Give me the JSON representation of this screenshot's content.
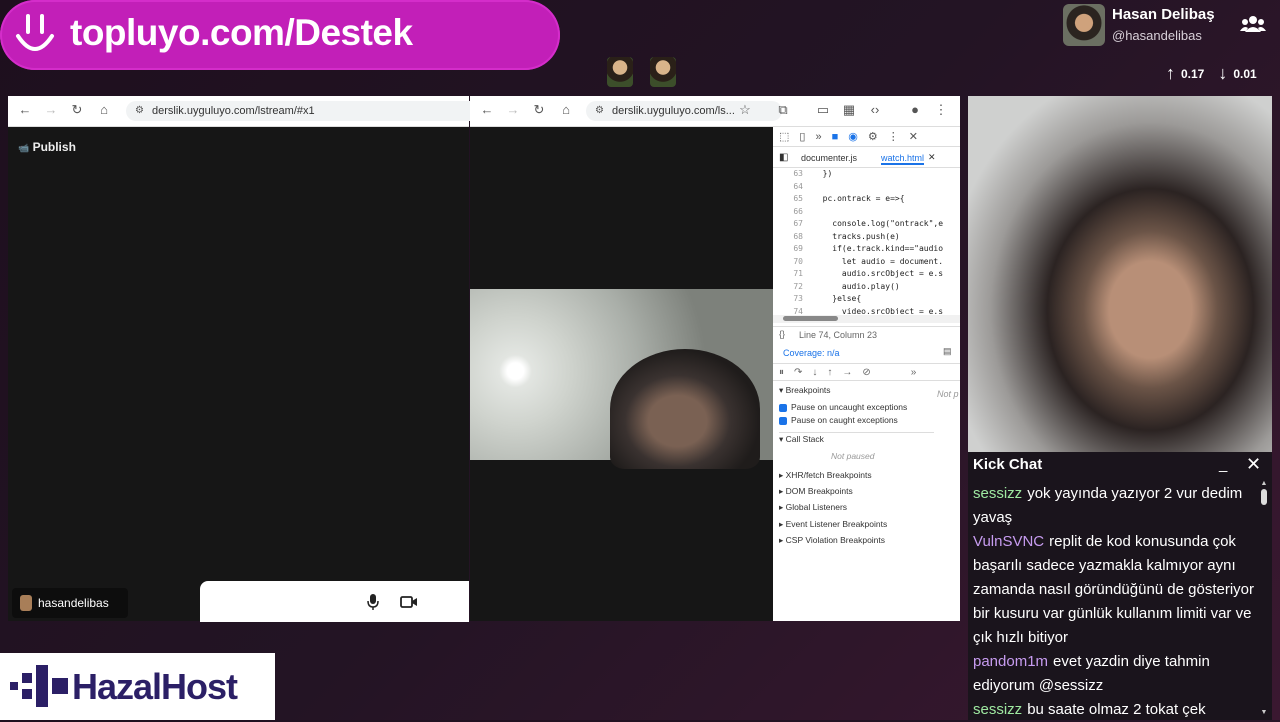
{
  "banner": {
    "text": "topluyo.com/Destek"
  },
  "profile": {
    "name": "Hasan Delibaş",
    "handle": "@hasandelibas",
    "up": "0.17",
    "down": "0.01"
  },
  "browser1": {
    "url": "derslik.uyguluyo.com/lstream/#x1",
    "publish": "Publish",
    "username": "hasandelibas"
  },
  "browser2": {
    "url": "derslik.uyguluyo.com/ls..."
  },
  "devtools": {
    "tabs": [
      "documenter.js",
      "watch.html"
    ],
    "lines": [
      {
        "n": "63",
        "c": "  })"
      },
      {
        "n": "64",
        "c": ""
      },
      {
        "n": "65",
        "c": "  pc.ontrack = e=>{"
      },
      {
        "n": "66",
        "c": ""
      },
      {
        "n": "67",
        "c": "    console.log(\"ontrack\",e"
      },
      {
        "n": "68",
        "c": "    tracks.push(e)"
      },
      {
        "n": "69",
        "c": "    if(e.track.kind==\"audio"
      },
      {
        "n": "70",
        "c": "      let audio = document."
      },
      {
        "n": "71",
        "c": "      audio.srcObject = e.s"
      },
      {
        "n": "72",
        "c": "      audio.play()"
      },
      {
        "n": "73",
        "c": "    }else{"
      },
      {
        "n": "74",
        "c": "      video.srcObject = e.s"
      }
    ],
    "status": "Line 74, Column 23",
    "coverage": "Coverage: n/a",
    "not_paused_side": "Not p",
    "breakpoints": "Breakpoints",
    "pause_uncaught": "Pause on uncaught exceptions",
    "pause_caught": "Pause on caught exceptions",
    "call_stack": "Call Stack",
    "not_paused": "Not paused",
    "sections": [
      "XHR/fetch Breakpoints",
      "DOM Breakpoints",
      "Global Listeners",
      "Event Listener Breakpoints",
      "CSP Violation Breakpoints"
    ]
  },
  "chat": {
    "title": "Kick Chat",
    "messages": [
      {
        "user": "sessizz",
        "color": "#9ee8a0",
        "text": "yok yayında yazıyor 2 vur dedim yavaş"
      },
      {
        "user": "VulnSVNC",
        "color": "#c79cf0",
        "text": "replit de kod konusunda çok başarılı sadece yazmakla kalmıyor aynı zamanda nasıl göründüğünü de gösteriyor bir kusuru var günlük kullanım limiti var ve çık hızlı bitiyor"
      },
      {
        "user": "pandom1m",
        "color": "#c79cf0",
        "text": "evet yazdin diye tahmin ediyorum @sessizz"
      },
      {
        "user": "sessizz",
        "color": "#9ee8a0",
        "text": "bu saate olmaz 2 tokat çek"
      }
    ]
  },
  "logo": {
    "text": "HazalHost"
  }
}
